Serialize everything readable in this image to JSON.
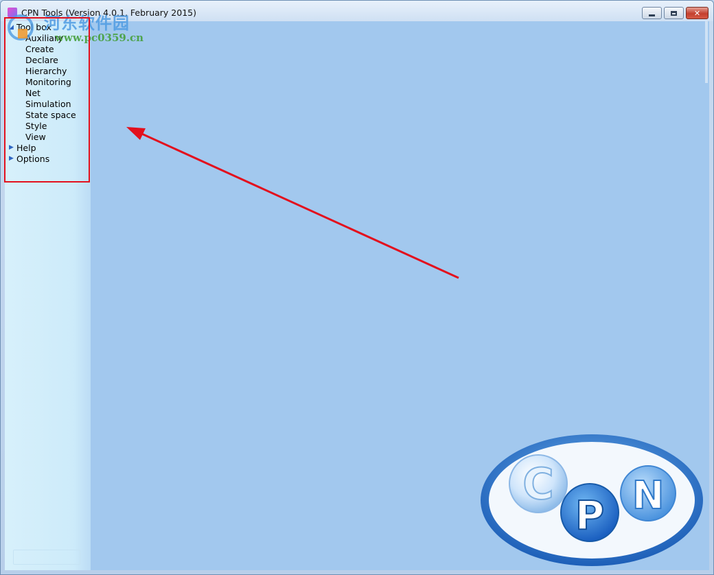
{
  "window": {
    "title": "CPN Tools (Version 4.0.1, February 2015)"
  },
  "tree": {
    "toolbox": {
      "label": "Tool box"
    },
    "toolbox_items": [
      "Auxiliary",
      "Create",
      "Declare",
      "Hierarchy",
      "Monitoring",
      "Net",
      "Simulation",
      "State space",
      "Style",
      "View"
    ],
    "help": {
      "label": "Help"
    },
    "options": {
      "label": "Options"
    }
  },
  "logo": {
    "letters": [
      "C",
      "P",
      "N"
    ]
  },
  "watermark": {
    "chinese": "河东软件园",
    "url": "www.pc0359.cn"
  },
  "icons": {
    "expand": "triangle-right",
    "collapse": "triangle-down",
    "minimize": "minimize-icon",
    "maximize": "maximize-icon",
    "close": "close-icon"
  },
  "colors": {
    "workspace": "#a2c8ee",
    "highlight": "#e3101d",
    "arrow": "#e3101d",
    "tree_toggle": "#2e66c4"
  }
}
